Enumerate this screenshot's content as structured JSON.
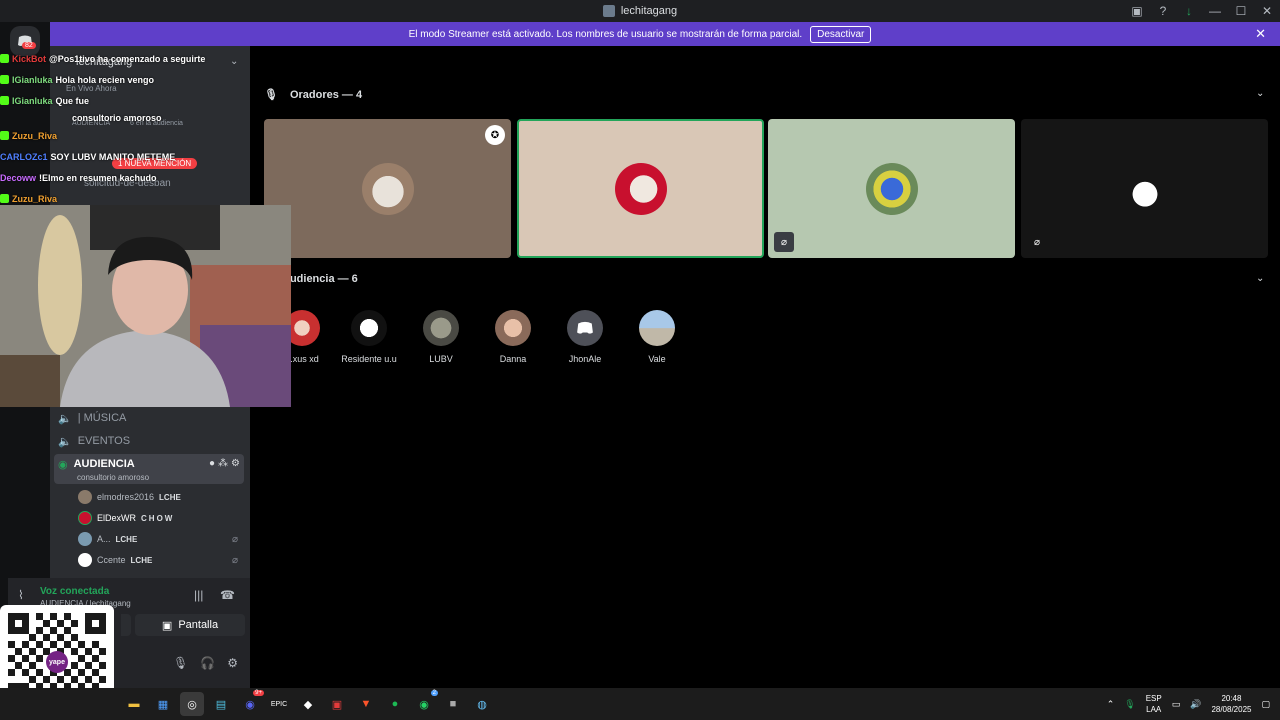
{
  "window": {
    "title": "lechitagang"
  },
  "banner": {
    "message": "El modo Streamer está activado. Los nombres de usuario se mostrarán de forma parcial.",
    "button": "Desactivar"
  },
  "rail": {
    "badge": "82"
  },
  "sidebar": {
    "server_name": "lechitagang",
    "live_label": "En Vivo Ahora",
    "stage_label": "AUDIENCIA",
    "audience_count": "6 en la audiencia",
    "mention_badge": "1 NUEVA MENCIÓN",
    "thread_channel": "solicitud-de-desban",
    "channels": [
      {
        "name": "| MÚSICA"
      },
      {
        "name": "EVENTOS"
      },
      {
        "name": "AUDIENCIA",
        "subtitle": "consultorio amoroso"
      }
    ],
    "voice_users": [
      {
        "name": "elmodres2016",
        "tag": "LCHE"
      },
      {
        "name": "ElDexWR",
        "tag": "CHOW"
      },
      {
        "name": "A...",
        "tag": "LCHE"
      },
      {
        "name": "Ccente",
        "tag": "LCHE"
      }
    ]
  },
  "voice_connection": {
    "status": "Voz conectada",
    "location": "AUDIENCIA / lechitagang",
    "screen_button": "Pantalla"
  },
  "speakers": {
    "header": "Oradores — 4"
  },
  "audience": {
    "header": "Audiencia — 6",
    "members": [
      {
        "name": "...xus xd"
      },
      {
        "name": "Residente u.u"
      },
      {
        "name": "LUBV"
      },
      {
        "name": "Danna"
      },
      {
        "name": "JhonAle"
      },
      {
        "name": "Vale"
      }
    ]
  },
  "overlay_chat": [
    {
      "user": "KickBot",
      "message": "@Pos1tivo ha comenzado a seguirte",
      "color": "#e33b3b"
    },
    {
      "user": "IGianluka",
      "message": "Hola hola recien vengo",
      "color": "#7fdc7f"
    },
    {
      "user": "IGianluka",
      "message": "Que fue",
      "color": "#7fdc7f"
    },
    {
      "user": "Zuzu_Riva",
      "message": "",
      "color": "#f0a030"
    },
    {
      "user": "CARLOZc1",
      "message": "SOY LUBV MANITO METEME",
      "color": "#4f7fff"
    },
    {
      "user": "Decoww",
      "message": "!Elmo en resumen kachudo",
      "color": "#c86bff"
    },
    {
      "user": "Zuzu_Riva",
      "message": "",
      "color": "#f0a030"
    }
  ],
  "overlay_extra": {
    "subtitle": "consultorio amoroso"
  },
  "qr": {
    "logo_text": "yape"
  },
  "taskbar": {
    "lang_top": "ESP",
    "lang_bottom": "LAA",
    "time": "20:48",
    "date": "28/08/2025",
    "badges": {
      "discord": "9+",
      "whatsapp": "2"
    }
  },
  "colors": {
    "banner": "#5f3fc9",
    "accent_green": "#23a55a",
    "sidebar": "#2b2d31"
  }
}
